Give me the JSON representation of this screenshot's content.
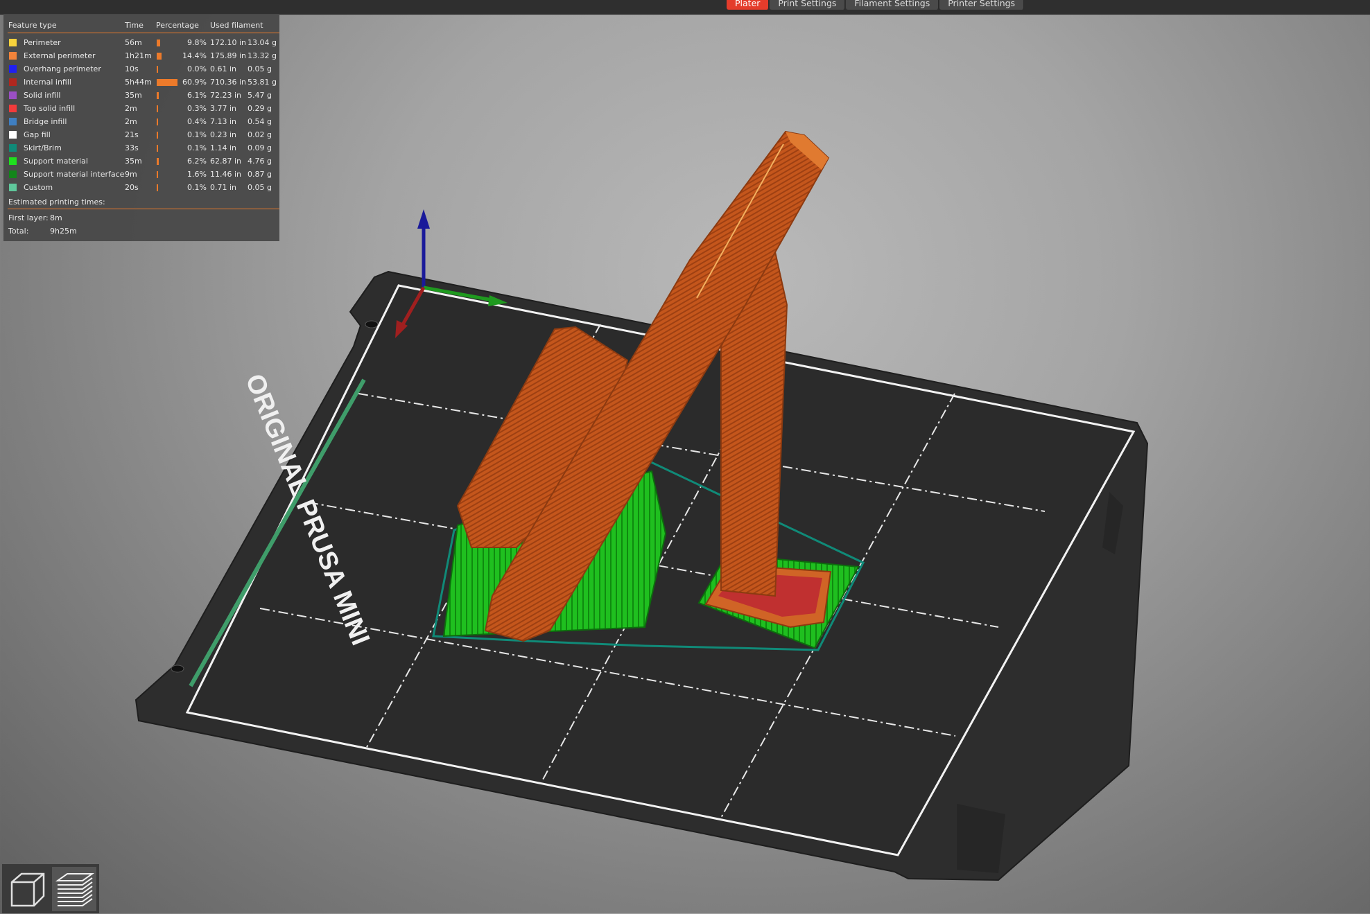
{
  "tabs": [
    {
      "label": "Plater",
      "active": true
    },
    {
      "label": "Print Settings",
      "active": false
    },
    {
      "label": "Filament Settings",
      "active": false
    },
    {
      "label": "Printer Settings",
      "active": false
    }
  ],
  "legend": {
    "headers": {
      "feature": "Feature type",
      "time": "Time",
      "percentage": "Percentage",
      "used": "Used filament"
    },
    "rows": [
      {
        "color": "#f7d23c",
        "label": "Perimeter",
        "time": "56m",
        "pct": "9.8%",
        "pct_value": 9.8,
        "length": "172.10 in",
        "weight": "13.04 g"
      },
      {
        "color": "#f2833a",
        "label": "External perimeter",
        "time": "1h21m",
        "pct": "14.4%",
        "pct_value": 14.4,
        "length": "175.89 in",
        "weight": "13.32 g"
      },
      {
        "color": "#2020f0",
        "label": "Overhang perimeter",
        "time": "10s",
        "pct": "0.0%",
        "pct_value": 0.0,
        "length": "0.61 in",
        "weight": "0.05 g"
      },
      {
        "color": "#b0271e",
        "label": "Internal infill",
        "time": "5h44m",
        "pct": "60.9%",
        "pct_value": 60.9,
        "length": "710.36 in",
        "weight": "53.81 g"
      },
      {
        "color": "#9a4fc4",
        "label": "Solid infill",
        "time": "35m",
        "pct": "6.1%",
        "pct_value": 6.1,
        "length": "72.23 in",
        "weight": "5.47 g"
      },
      {
        "color": "#f23b3b",
        "label": "Top solid infill",
        "time": "2m",
        "pct": "0.3%",
        "pct_value": 0.3,
        "length": "3.77 in",
        "weight": "0.29 g"
      },
      {
        "color": "#3f7fc2",
        "label": "Bridge infill",
        "time": "2m",
        "pct": "0.4%",
        "pct_value": 0.4,
        "length": "7.13 in",
        "weight": "0.54 g"
      },
      {
        "color": "#ffffff",
        "label": "Gap fill",
        "time": "21s",
        "pct": "0.1%",
        "pct_value": 0.1,
        "length": "0.23 in",
        "weight": "0.02 g"
      },
      {
        "color": "#108a78",
        "label": "Skirt/Brim",
        "time": "33s",
        "pct": "0.1%",
        "pct_value": 0.1,
        "length": "1.14 in",
        "weight": "0.09 g"
      },
      {
        "color": "#1fdf1f",
        "label": "Support material",
        "time": "35m",
        "pct": "6.2%",
        "pct_value": 6.2,
        "length": "62.87 in",
        "weight": "4.76 g"
      },
      {
        "color": "#12861a",
        "label": "Support material interface",
        "time": "9m",
        "pct": "1.6%",
        "pct_value": 1.6,
        "length": "11.46 in",
        "weight": "0.87 g"
      },
      {
        "color": "#5fc79b",
        "label": "Custom",
        "time": "20s",
        "pct": "0.1%",
        "pct_value": 0.1,
        "length": "0.71 in",
        "weight": "0.05 g"
      }
    ],
    "estimated_title": "Estimated printing times:",
    "first_layer_label": "First layer:",
    "first_layer_value": "8m",
    "total_label": "Total:",
    "total_value": "9h25m"
  },
  "bed": {
    "label": "ORIGINAL PRUSA MINI"
  },
  "view_toggle": [
    {
      "icon": "3d-view-icon"
    },
    {
      "icon": "preview-layers-icon"
    }
  ]
}
